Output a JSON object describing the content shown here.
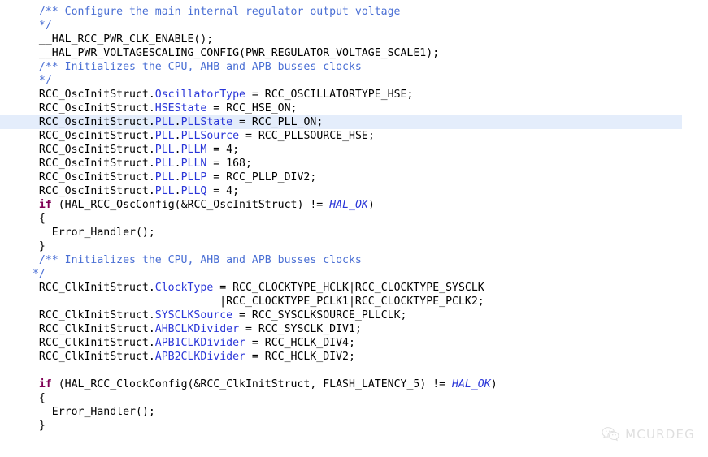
{
  "editor": {
    "language": "c",
    "background_color": "#ffffff",
    "current_line_highlight_color": "#e4edfb",
    "colors": {
      "comment": "#4a6fd4",
      "keyword": "#7f0055",
      "field": "#2a36d8",
      "macro_italic": "#2a36d8",
      "plain": "#000000"
    },
    "current_line_number": 5
  },
  "watermark": {
    "logo_icon": "wechat-icon",
    "text": "MCURDEG",
    "color": "#b4b4b4"
  },
  "code": {
    "lines": [
      {
        "id": 0,
        "current": false,
        "segments": [
          {
            "t": "comment",
            "v": "  /** Configure the main internal regulator output voltage"
          }
        ]
      },
      {
        "id": 1,
        "current": false,
        "segments": [
          {
            "t": "comment",
            "v": "  */"
          }
        ]
      },
      {
        "id": 2,
        "current": false,
        "segments": [
          {
            "t": "plain",
            "v": "  __HAL_RCC_PWR_CLK_ENABLE();"
          }
        ]
      },
      {
        "id": 3,
        "current": false,
        "segments": [
          {
            "t": "plain",
            "v": "  __HAL_PWR_VOLTAGESCALING_CONFIG(PWR_REGULATOR_VOLTAGE_SCALE1);"
          }
        ]
      },
      {
        "id": 4,
        "current": false,
        "segments": [
          {
            "t": "comment",
            "v": "  /** Initializes the CPU, AHB and APB busses clocks"
          }
        ]
      },
      {
        "id": 5,
        "current": false,
        "segments": [
          {
            "t": "comment",
            "v": "  */"
          }
        ]
      },
      {
        "id": 6,
        "current": false,
        "segments": [
          {
            "t": "plain",
            "v": "  RCC_OscInitStruct."
          },
          {
            "t": "field",
            "v": "OscillatorType"
          },
          {
            "t": "plain",
            "v": " = RCC_OSCILLATORTYPE_HSE;"
          }
        ]
      },
      {
        "id": 7,
        "current": false,
        "segments": [
          {
            "t": "plain",
            "v": "  RCC_OscInitStruct."
          },
          {
            "t": "field",
            "v": "HSEState"
          },
          {
            "t": "plain",
            "v": " = RCC_HSE_ON;"
          }
        ]
      },
      {
        "id": 8,
        "current": true,
        "segments": [
          {
            "t": "plain",
            "v": "  RCC_OscInitStruct."
          },
          {
            "t": "field",
            "v": "PLL"
          },
          {
            "t": "plain",
            "v": "."
          },
          {
            "t": "field",
            "v": "PLLState"
          },
          {
            "t": "plain",
            "v": " = RCC_PLL_ON;"
          }
        ]
      },
      {
        "id": 9,
        "current": false,
        "segments": [
          {
            "t": "plain",
            "v": "  RCC_OscInitStruct."
          },
          {
            "t": "field",
            "v": "PLL"
          },
          {
            "t": "plain",
            "v": "."
          },
          {
            "t": "field",
            "v": "PLLSource"
          },
          {
            "t": "plain",
            "v": " = RCC_PLLSOURCE_HSE;"
          }
        ]
      },
      {
        "id": 10,
        "current": false,
        "segments": [
          {
            "t": "plain",
            "v": "  RCC_OscInitStruct."
          },
          {
            "t": "field",
            "v": "PLL"
          },
          {
            "t": "plain",
            "v": "."
          },
          {
            "t": "field",
            "v": "PLLM"
          },
          {
            "t": "plain",
            "v": " = 4;"
          }
        ]
      },
      {
        "id": 11,
        "current": false,
        "segments": [
          {
            "t": "plain",
            "v": "  RCC_OscInitStruct."
          },
          {
            "t": "field",
            "v": "PLL"
          },
          {
            "t": "plain",
            "v": "."
          },
          {
            "t": "field",
            "v": "PLLN"
          },
          {
            "t": "plain",
            "v": " = 168;"
          }
        ]
      },
      {
        "id": 12,
        "current": false,
        "segments": [
          {
            "t": "plain",
            "v": "  RCC_OscInitStruct."
          },
          {
            "t": "field",
            "v": "PLL"
          },
          {
            "t": "plain",
            "v": "."
          },
          {
            "t": "field",
            "v": "PLLP"
          },
          {
            "t": "plain",
            "v": " = RCC_PLLP_DIV2;"
          }
        ]
      },
      {
        "id": 13,
        "current": false,
        "segments": [
          {
            "t": "plain",
            "v": "  RCC_OscInitStruct."
          },
          {
            "t": "field",
            "v": "PLL"
          },
          {
            "t": "plain",
            "v": "."
          },
          {
            "t": "field",
            "v": "PLLQ"
          },
          {
            "t": "plain",
            "v": " = 4;"
          }
        ]
      },
      {
        "id": 14,
        "current": false,
        "segments": [
          {
            "t": "plain",
            "v": "  "
          },
          {
            "t": "keyword",
            "v": "if"
          },
          {
            "t": "plain",
            "v": " (HAL_RCC_OscConfig(&RCC_OscInitStruct) != "
          },
          {
            "t": "macro",
            "v": "HAL_OK"
          },
          {
            "t": "plain",
            "v": ")"
          }
        ]
      },
      {
        "id": 15,
        "current": false,
        "segments": [
          {
            "t": "plain",
            "v": "  {"
          }
        ]
      },
      {
        "id": 16,
        "current": false,
        "segments": [
          {
            "t": "plain",
            "v": "    Error_Handler();"
          }
        ]
      },
      {
        "id": 17,
        "current": false,
        "segments": [
          {
            "t": "plain",
            "v": "  }"
          }
        ]
      },
      {
        "id": 18,
        "current": false,
        "segments": [
          {
            "t": "comment",
            "v": "  /** Initializes the CPU, AHB and APB busses clocks"
          }
        ]
      },
      {
        "id": 19,
        "current": false,
        "segments": [
          {
            "t": "comment",
            "v": " */"
          }
        ]
      },
      {
        "id": 20,
        "current": false,
        "segments": [
          {
            "t": "plain",
            "v": "  RCC_ClkInitStruct."
          },
          {
            "t": "field",
            "v": "ClockType"
          },
          {
            "t": "plain",
            "v": " = RCC_CLOCKTYPE_HCLK|RCC_CLOCKTYPE_SYSCLK"
          }
        ]
      },
      {
        "id": 21,
        "current": false,
        "segments": [
          {
            "t": "plain",
            "v": "                              |RCC_CLOCKTYPE_PCLK1|RCC_CLOCKTYPE_PCLK2;"
          }
        ]
      },
      {
        "id": 22,
        "current": false,
        "segments": [
          {
            "t": "plain",
            "v": "  RCC_ClkInitStruct."
          },
          {
            "t": "field",
            "v": "SYSCLKSource"
          },
          {
            "t": "plain",
            "v": " = RCC_SYSCLKSOURCE_PLLCLK;"
          }
        ]
      },
      {
        "id": 23,
        "current": false,
        "segments": [
          {
            "t": "plain",
            "v": "  RCC_ClkInitStruct."
          },
          {
            "t": "field",
            "v": "AHBCLKDivider"
          },
          {
            "t": "plain",
            "v": " = RCC_SYSCLK_DIV1;"
          }
        ]
      },
      {
        "id": 24,
        "current": false,
        "segments": [
          {
            "t": "plain",
            "v": "  RCC_ClkInitStruct."
          },
          {
            "t": "field",
            "v": "APB1CLKDivider"
          },
          {
            "t": "plain",
            "v": " = RCC_HCLK_DIV4;"
          }
        ]
      },
      {
        "id": 25,
        "current": false,
        "segments": [
          {
            "t": "plain",
            "v": "  RCC_ClkInitStruct."
          },
          {
            "t": "field",
            "v": "APB2CLKDivider"
          },
          {
            "t": "plain",
            "v": " = RCC_HCLK_DIV2;"
          }
        ]
      },
      {
        "id": 26,
        "current": false,
        "segments": [
          {
            "t": "plain",
            "v": ""
          }
        ]
      },
      {
        "id": 27,
        "current": false,
        "segments": [
          {
            "t": "plain",
            "v": "  "
          },
          {
            "t": "keyword",
            "v": "if"
          },
          {
            "t": "plain",
            "v": " (HAL_RCC_ClockConfig(&RCC_ClkInitStruct, FLASH_LATENCY_5) != "
          },
          {
            "t": "macro",
            "v": "HAL_OK"
          },
          {
            "t": "plain",
            "v": ")"
          }
        ]
      },
      {
        "id": 28,
        "current": false,
        "segments": [
          {
            "t": "plain",
            "v": "  {"
          }
        ]
      },
      {
        "id": 29,
        "current": false,
        "segments": [
          {
            "t": "plain",
            "v": "    Error_Handler();"
          }
        ]
      },
      {
        "id": 30,
        "current": false,
        "segments": [
          {
            "t": "plain",
            "v": "  }"
          }
        ]
      }
    ]
  }
}
